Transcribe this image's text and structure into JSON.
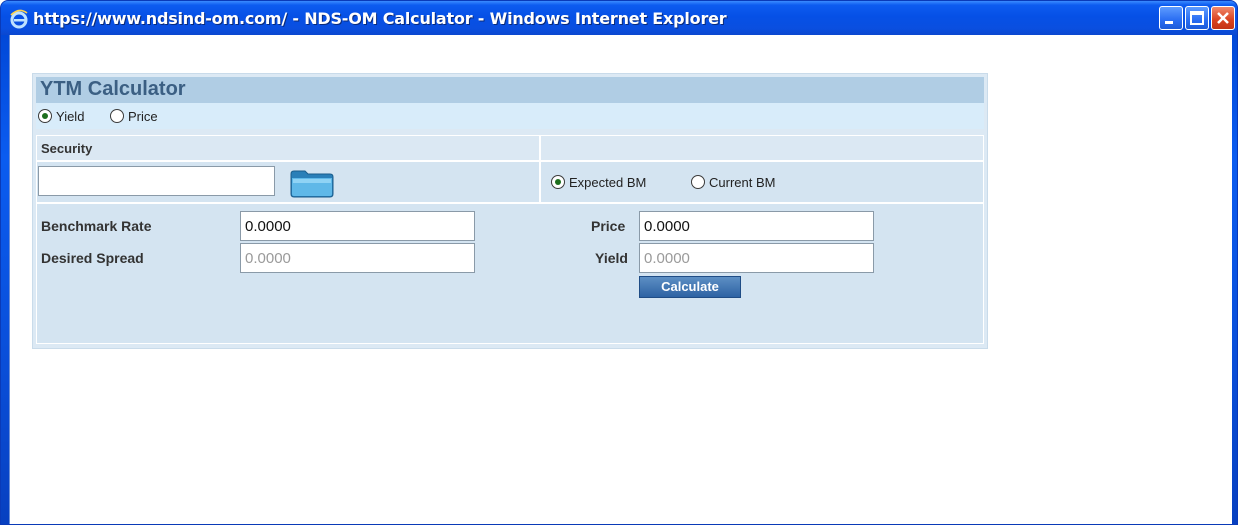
{
  "window": {
    "title": "https://www.ndsind-om.com/ - NDS-OM Calculator - Windows Internet Explorer",
    "buttons": [
      "minimize",
      "maximize",
      "close"
    ]
  },
  "calculator": {
    "title": "YTM Calculator",
    "mode_options": [
      {
        "label": "Yield",
        "checked": true
      },
      {
        "label": "Price",
        "checked": false
      }
    ],
    "security": {
      "label": "Security",
      "value": "",
      "browse_icon": "folder-icon"
    },
    "benchmark_options": [
      {
        "label": "Expected BM",
        "checked": true
      },
      {
        "label": "Current BM",
        "checked": false
      }
    ],
    "fields": {
      "benchmark_rate": {
        "label": "Benchmark Rate",
        "value": "0.0000"
      },
      "desired_spread": {
        "label": "Desired Spread",
        "value": "0.0000"
      },
      "price": {
        "label": "Price",
        "value": "0.0000"
      },
      "yield": {
        "label": "Yield",
        "value": "0.0000"
      }
    },
    "calculate_label": "Calculate"
  },
  "colors": {
    "titlebar": "#0a54e3",
    "panel_header": "#b0cde4",
    "panel_body": "#dce9f4",
    "button": "#2d62a3"
  }
}
